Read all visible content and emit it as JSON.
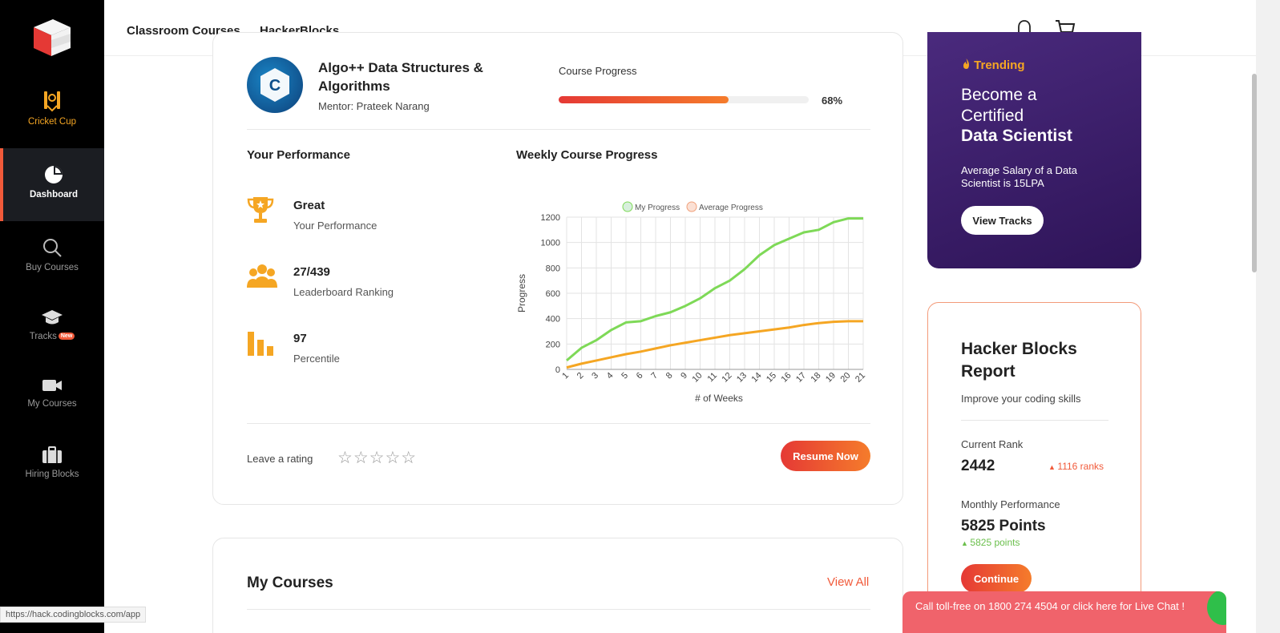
{
  "sidebar": {
    "items": [
      {
        "label": "Cricket Cup",
        "icon": "cricket-icon"
      },
      {
        "label": "Dashboard",
        "icon": "pie-chart-icon"
      },
      {
        "label": "Buy Courses",
        "icon": "search-icon"
      },
      {
        "label": "Tracks",
        "icon": "graduation-cap-icon",
        "badge": "New"
      },
      {
        "label": "My Courses",
        "icon": "video-camera-icon"
      },
      {
        "label": "Hiring Blocks",
        "icon": "briefcase-icon"
      }
    ]
  },
  "topnav": {
    "links": [
      "Classroom Courses",
      "HackerBlocks"
    ]
  },
  "course": {
    "title": "Algo++ Data Structures & Algorithms",
    "mentor": "Mentor: Prateek Narang",
    "progress_label": "Course Progress",
    "progress_value": 0.68,
    "progress_text": "68%"
  },
  "performance": {
    "heading": "Your Performance",
    "items": [
      {
        "value": "Great",
        "label": "Your Performance",
        "icon": "trophy-icon"
      },
      {
        "value": "27/439",
        "label": "Leaderboard Ranking",
        "icon": "users-icon"
      },
      {
        "value": "97",
        "label": "Percentile",
        "icon": "bar-chart-icon"
      }
    ]
  },
  "weekly": {
    "heading": "Weekly Course Progress"
  },
  "chart_data": {
    "type": "line",
    "title": "",
    "xlabel": "# of Weeks",
    "ylabel": "Progress",
    "ylim": [
      0,
      1200
    ],
    "yticks": [
      0,
      200,
      400,
      600,
      800,
      1000,
      1200
    ],
    "x": [
      1,
      2,
      3,
      4,
      5,
      6,
      7,
      8,
      9,
      10,
      11,
      12,
      13,
      14,
      15,
      16,
      17,
      18,
      19,
      20,
      21
    ],
    "series": [
      {
        "name": "My Progress",
        "color": "#7ed957",
        "values": [
          70,
          170,
          230,
          310,
          370,
          380,
          420,
          450,
          500,
          560,
          640,
          700,
          790,
          900,
          980,
          1030,
          1080,
          1100,
          1160,
          1190,
          1190
        ]
      },
      {
        "name": "Average Progress",
        "color": "#f5a623",
        "values": [
          15,
          45,
          70,
          95,
          120,
          140,
          165,
          190,
          210,
          230,
          250,
          270,
          285,
          300,
          315,
          330,
          350,
          365,
          375,
          380,
          380
        ]
      }
    ],
    "grid": true,
    "legend": "top"
  },
  "rating": {
    "label": "Leave a rating",
    "stars": "☆☆☆☆☆",
    "resume_label": "Resume Now"
  },
  "my_courses": {
    "title": "My Courses",
    "view_all": "View All"
  },
  "promo": {
    "tag": "Trending",
    "line1": "Become a Certified",
    "line2": "Data Scientist",
    "sub": "Average Salary of a Data Scientist is 15LPA",
    "button": "View Tracks"
  },
  "report": {
    "title": "Hacker Blocks Report",
    "subtitle": "Improve your coding skills",
    "rank_label": "Current Rank",
    "rank_value": "2442",
    "rank_delta": "1116 ranks",
    "monthly_label": "Monthly Performance",
    "monthly_value": "5825 Points",
    "monthly_delta": "5825 points",
    "button": "Continue"
  },
  "status_url": "https://hack.codingblocks.com/app",
  "livechat": "Call toll-free on 1800 274 4504 or click here for Live Chat !",
  "colors": {
    "accent": "#f15a3a",
    "sidebar_bg": "#000000",
    "promo_bg": "#3b1f6b"
  }
}
